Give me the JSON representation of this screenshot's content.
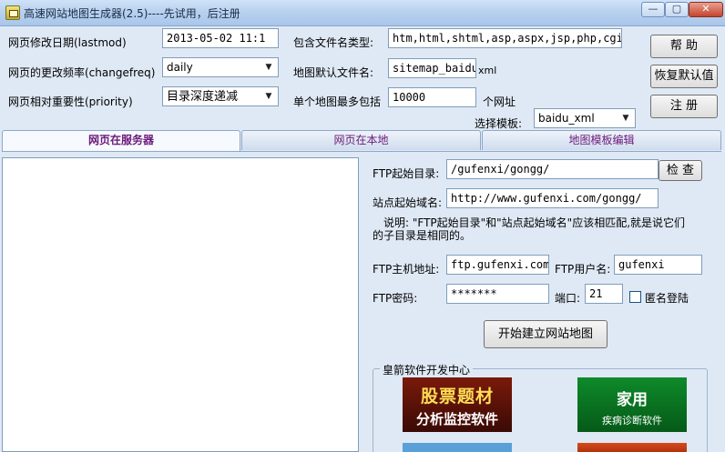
{
  "window": {
    "title": "高速网站地图生成器(2.5)----先试用，后注册",
    "min_glyph": "—",
    "max_glyph": "▢",
    "close_glyph": "✕"
  },
  "settings": {
    "lastmod_label": "网页修改日期(lastmod)",
    "lastmod_value": "2013-05-02 11:1",
    "changefreq_label": "网页的更改频率(changefreq)",
    "changefreq_value": "daily",
    "priority_label": "网页相对重要性(priority)",
    "priority_value": "目录深度递减",
    "filetypes_label": "包含文件名类型:",
    "filetypes_value": "htm,html,shtml,asp,aspx,jsp,php,cgi",
    "default_filename_label": "地图默认文件名:",
    "default_filename_value": "sitemap_baidu",
    "default_filename_suffix": "xml",
    "max_urls_label": "单个地图最多包括",
    "max_urls_value": "10000",
    "max_urls_suffix": "个网址",
    "template_label": "选择模板:",
    "template_value": "baidu_xml"
  },
  "buttons": {
    "help": "帮 助",
    "restore_defaults": "恢复默认值",
    "register": "注 册",
    "browse": "检 查",
    "start": "开始建立网站地图"
  },
  "tabs": [
    {
      "label": "网页在服务器"
    },
    {
      "label": "网页在本地"
    },
    {
      "label": "地图模板编辑"
    }
  ],
  "ftp": {
    "start_dir_label": "FTP起始目录:",
    "start_dir_value": "/gufenxi/gongg/",
    "site_domain_label": "站点起始域名:",
    "site_domain_value": "http://www.gufenxi.com/gongg/",
    "note_line1": "说明: \"FTP起始目录\"和\"站点起始域名\"应该相匹配,就是说它们",
    "note_line2": "的子目录是相同的。",
    "host_label": "FTP主机地址:",
    "host_value": "ftp.gufenxi.com",
    "user_label": "FTP用户名:",
    "user_value": "gufenxi",
    "password_label": "FTP密码:",
    "password_value": "*******",
    "port_label": "端口:",
    "port_value": "21",
    "anonymous_label": "匿名登陆"
  },
  "ads": {
    "group_title": "皇箭软件开发中心",
    "stock_line1": "股票题材",
    "stock_line2": "分析监控软件",
    "home_line1": "家用",
    "home_line2": "疾病诊断软件"
  }
}
